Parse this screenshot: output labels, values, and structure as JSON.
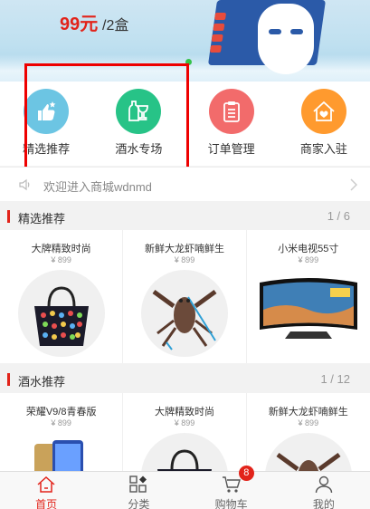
{
  "banner": {
    "price": "99元",
    "unit": "/2盒"
  },
  "nav": {
    "items": [
      {
        "label": "精选推荐",
        "color": "#6cc5e3",
        "icon": "thumbs-up-icon"
      },
      {
        "label": "酒水专场",
        "color": "#27c387",
        "icon": "wine-icon"
      },
      {
        "label": "订单管理",
        "color": "#f26b6b",
        "icon": "clipboard-icon"
      },
      {
        "label": "商家入驻",
        "color": "#ff9a2e",
        "icon": "store-house-icon"
      }
    ]
  },
  "notice": {
    "text": "欢迎进入商城wdnmd"
  },
  "sections": [
    {
      "title": "精选推荐",
      "page": "1 / 6",
      "products": [
        {
          "name": "大牌精致时尚",
          "price": "¥ 899"
        },
        {
          "name": "新鲜大龙虾喃鲜生",
          "price": "¥ 899"
        },
        {
          "name": "小米电视55寸",
          "price": "¥ 899"
        }
      ]
    },
    {
      "title": "酒水推荐",
      "page": "1 / 12",
      "products": [
        {
          "name": "荣耀V9/8青春版",
          "price": "¥ 899"
        },
        {
          "name": "大牌精致时尚",
          "price": "¥ 899"
        },
        {
          "name": "新鲜大龙虾喃鲜生",
          "price": "¥ 899"
        }
      ]
    }
  ],
  "tabbar": {
    "items": [
      {
        "label": "首页",
        "icon": "home-icon"
      },
      {
        "label": "分类",
        "icon": "category-icon"
      },
      {
        "label": "购物车",
        "icon": "cart-icon",
        "badge": "8"
      },
      {
        "label": "我的",
        "icon": "user-icon"
      }
    ]
  },
  "colors": {
    "accent": "#e2231a"
  }
}
